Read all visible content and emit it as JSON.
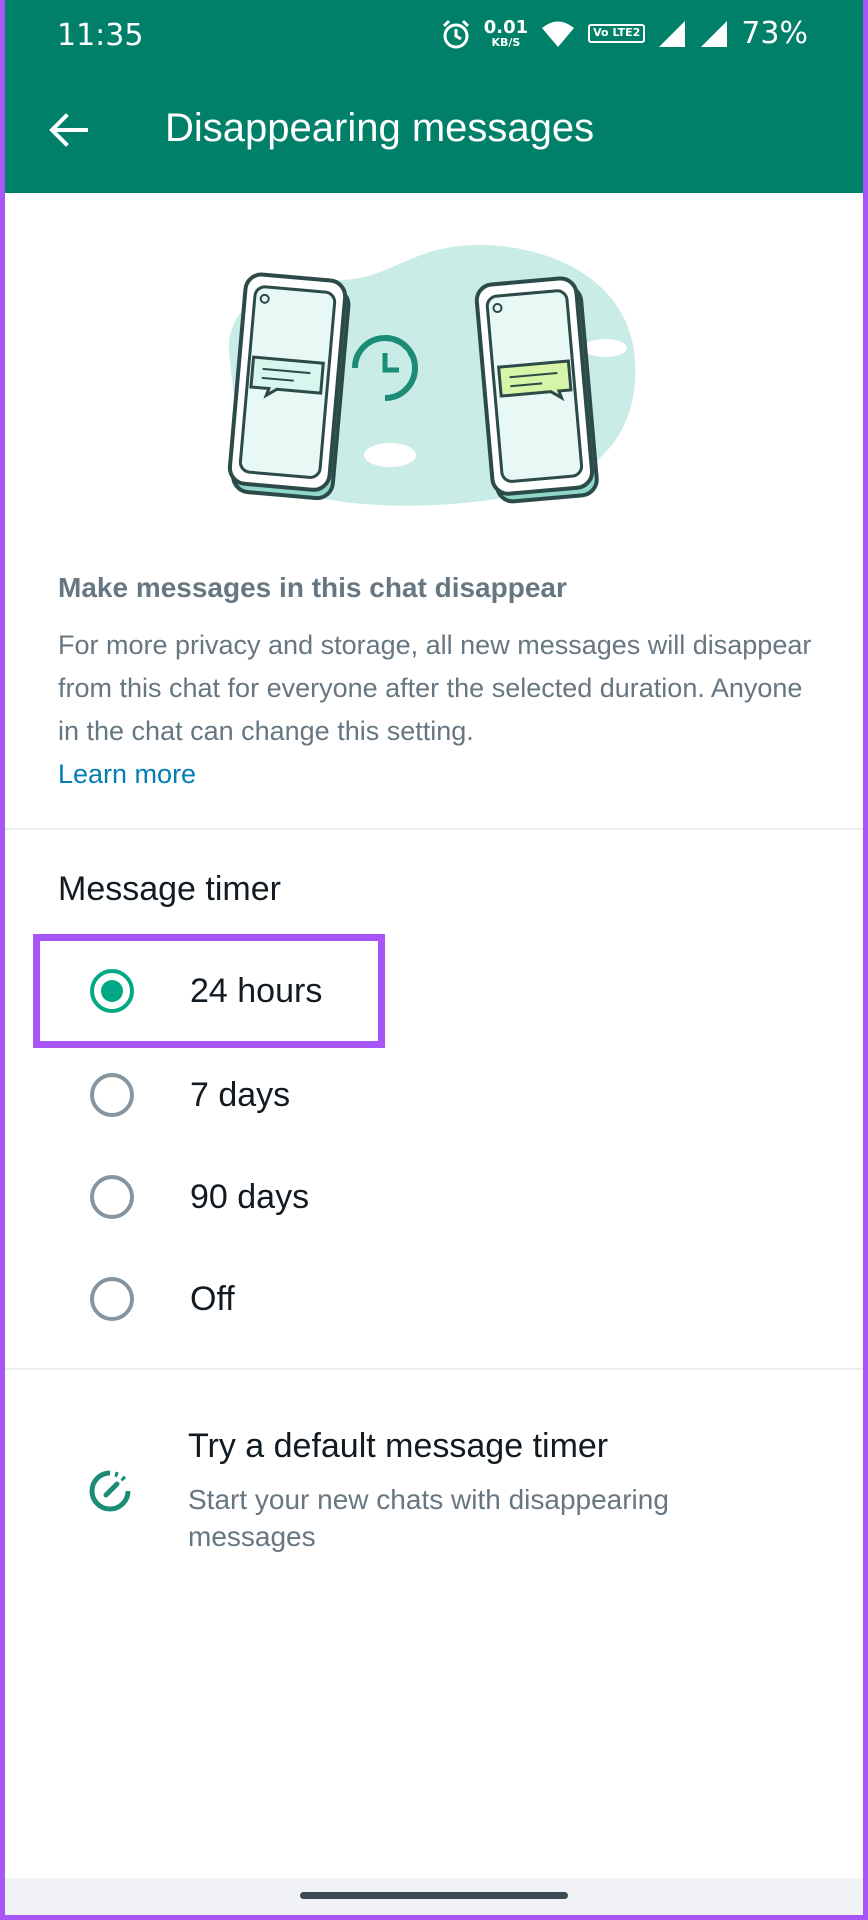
{
  "status_bar": {
    "time": "11:35",
    "net_speed_value": "0.01",
    "net_speed_unit": "KB/S",
    "volte_label": "Vo LTE2",
    "battery": "73%"
  },
  "header": {
    "title": "Disappearing messages"
  },
  "info": {
    "heading": "Make messages in this chat disappear",
    "body": "For more privacy and storage, all new messages will disappear from this chat for everyone after the selected duration. Anyone in the chat can change this setting.",
    "link": "Learn more"
  },
  "timer": {
    "section_title": "Message timer",
    "options": [
      {
        "label": "24 hours",
        "selected": true
      },
      {
        "label": "7 days",
        "selected": false
      },
      {
        "label": "90 days",
        "selected": false
      },
      {
        "label": "Off",
        "selected": false
      }
    ]
  },
  "default_timer": {
    "title": "Try a default message timer",
    "subtitle": "Start your new chats with disappearing messages"
  },
  "colors": {
    "brand_green": "#008069",
    "accent_green": "#00a884",
    "link_blue": "#027eb5",
    "highlight_purple": "#a855f7"
  }
}
